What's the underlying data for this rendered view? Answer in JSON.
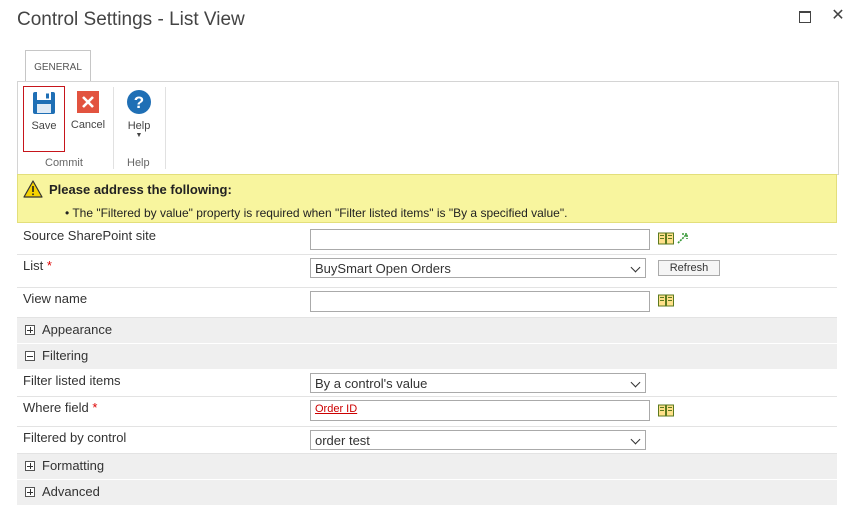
{
  "window": {
    "title": "Control Settings - List View"
  },
  "ribbon": {
    "tab_label": "GENERAL",
    "save_label": "Save",
    "cancel_label": "Cancel",
    "help_label": "Help",
    "commit_group": "Commit",
    "help_group": "Help"
  },
  "validation": {
    "title": "Please address the following:",
    "message": "• The \"Filtered by value\" property is required when \"Filter listed items\" is \"By a specified value\"."
  },
  "form": {
    "source_site_label": "Source SharePoint site",
    "source_site_value": "",
    "list_label": "List",
    "required_mark": "*",
    "list_value": "BuySmart Open Orders",
    "refresh_label": "Refresh",
    "view_name_label": "View name",
    "view_name_value": "",
    "appearance_label": "Appearance",
    "filtering_label": "Filtering",
    "filter_items_label": "Filter listed items",
    "filter_items_value": "By a control's value",
    "where_field_label": "Where field",
    "where_field_value": "Order ID",
    "filtered_by_control_label": "Filtered by control",
    "filtered_by_control_value": "order test",
    "formatting_label": "Formatting",
    "advanced_label": "Advanced"
  },
  "colors": {
    "warning_bg": "#f8f59e",
    "save_icon": "#1f6fb5",
    "cancel_icon": "#e2533f",
    "help_icon": "#1f6fb5",
    "required": "#dd0000"
  }
}
